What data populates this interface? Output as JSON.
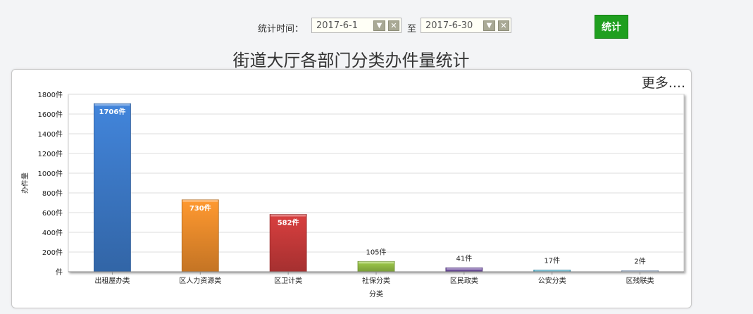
{
  "filter": {
    "label": "统计时间：",
    "start_date": "2017-6-1",
    "to_text": "至",
    "end_date": "2017-6-30",
    "submit_label": "统计"
  },
  "page_title": "街道大厅各部门分类办件量统计",
  "more_link": "更多....",
  "chart_data": {
    "type": "bar",
    "title": "",
    "xlabel": "分类",
    "ylabel": "办件量",
    "ylim": [
      0,
      1800
    ],
    "ytick_step": 200,
    "ytick_labels": [
      "件",
      "200件",
      "400件",
      "600件",
      "800件",
      "1000件",
      "1200件",
      "1400件",
      "1600件",
      "1800件"
    ],
    "categories": [
      "出租屋办类",
      "区人力资源类",
      "区卫计类",
      "社保分类",
      "区民政类",
      "公安分类",
      "区残联类"
    ],
    "values": [
      1706,
      730,
      582,
      105,
      41,
      17,
      2
    ],
    "data_labels": [
      "1706件",
      "730件",
      "582件",
      "105件",
      "41件",
      "17件",
      "2件"
    ],
    "colors": [
      "#3d7bcb",
      "#ef8e2c",
      "#c93a3a",
      "#94be45",
      "#7352a3",
      "#3aa7c6",
      "#9ab7d8"
    ],
    "grid": true,
    "legend": "none"
  }
}
